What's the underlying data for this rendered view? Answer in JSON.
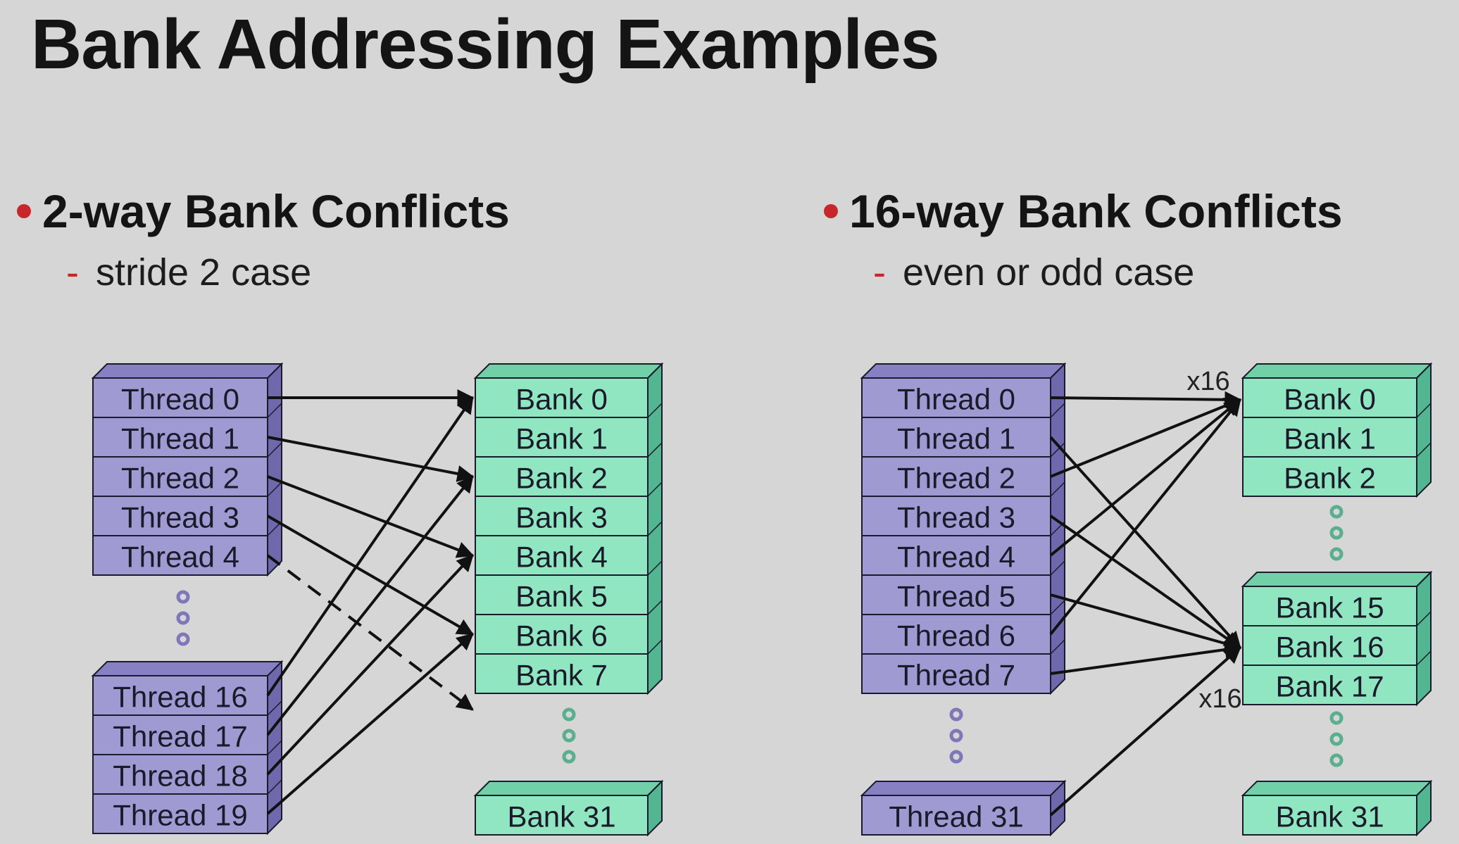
{
  "title": "Bank Addressing Examples",
  "sections": [
    {
      "heading": "2-way Bank Conflicts",
      "subheading": "stride 2 case",
      "threads": [
        "Thread 0",
        "Thread 1",
        "Thread 2",
        "Thread 3",
        "Thread 4",
        "Thread 16",
        "Thread 17",
        "Thread 18",
        "Thread 19"
      ],
      "banks": [
        "Bank 0",
        "Bank 1",
        "Bank 2",
        "Bank 3",
        "Bank 4",
        "Bank 5",
        "Bank 6",
        "Bank 7",
        "Bank 31"
      ],
      "mappings": [
        {
          "thread": "Thread 0",
          "bank": "Bank 0"
        },
        {
          "thread": "Thread 1",
          "bank": "Bank 2"
        },
        {
          "thread": "Thread 2",
          "bank": "Bank 4"
        },
        {
          "thread": "Thread 3",
          "bank": "Bank 6"
        },
        {
          "thread": "Thread 4",
          "bank": "Bank 8",
          "style": "dashed"
        },
        {
          "thread": "Thread 16",
          "bank": "Bank 0"
        },
        {
          "thread": "Thread 17",
          "bank": "Bank 2"
        },
        {
          "thread": "Thread 18",
          "bank": "Bank 4"
        },
        {
          "thread": "Thread 19",
          "bank": "Bank 6"
        }
      ]
    },
    {
      "heading": "16-way Bank Conflicts",
      "subheading": "even or odd case",
      "threads": [
        "Thread 0",
        "Thread 1",
        "Thread 2",
        "Thread 3",
        "Thread 4",
        "Thread 5",
        "Thread 6",
        "Thread 7",
        "Thread 31"
      ],
      "banks": [
        "Bank 0",
        "Bank 1",
        "Bank 2",
        "Bank 15",
        "Bank 16",
        "Bank 17",
        "Bank 31"
      ],
      "mappings": [
        {
          "thread": "Thread 0",
          "bank": "Bank 0"
        },
        {
          "thread": "Thread 2",
          "bank": "Bank 0"
        },
        {
          "thread": "Thread 4",
          "bank": "Bank 0"
        },
        {
          "thread": "Thread 6",
          "bank": "Bank 0"
        },
        {
          "thread": "Thread 1",
          "bank": "Bank 16"
        },
        {
          "thread": "Thread 3",
          "bank": "Bank 16"
        },
        {
          "thread": "Thread 5",
          "bank": "Bank 16"
        },
        {
          "thread": "Thread 7",
          "bank": "Bank 16"
        },
        {
          "thread": "Thread 31",
          "bank": "Bank 16"
        }
      ],
      "multipliers": [
        "x16",
        "x16"
      ]
    }
  ],
  "colors": {
    "thread_fill": "#a09ad2",
    "thread_side": "#6f68ac",
    "thread_top": "#8780c2",
    "bank_fill": "#8fe6c0",
    "bank_side": "#52b690",
    "bank_top": "#72d0a8",
    "outline": "#1b1b2e",
    "dots_thread": "#7e78b8",
    "dots_bank": "#5aaf8e"
  }
}
